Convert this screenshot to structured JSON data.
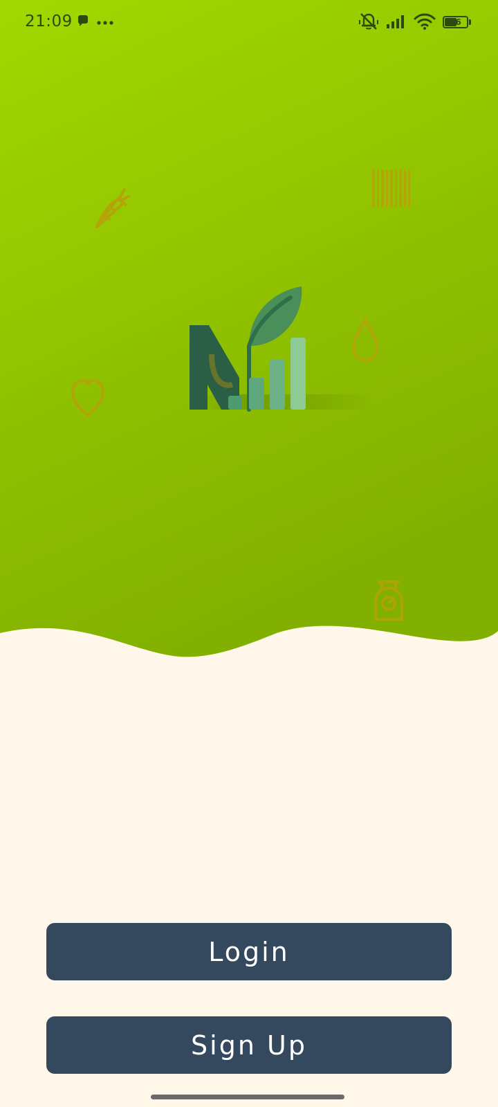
{
  "status_bar": {
    "time": "21:09",
    "battery_level": "56",
    "left_icons": [
      "chat-bubble-icon",
      "more-dots-icon"
    ],
    "right_icons": [
      "vibrate-mute-icon",
      "signal-icon",
      "wifi-icon",
      "battery-icon"
    ]
  },
  "hero": {
    "gradient_top": "#A2D800",
    "gradient_bottom": "#82B000",
    "doodle_color": "#B8A00A",
    "doodles": [
      "carrot-icon",
      "barcode-icon",
      "water-drop-icon",
      "heart-icon",
      "scale-icon"
    ],
    "logo": {
      "name": "app-logo",
      "colors": {
        "letter": "#2A5E45",
        "leaf": "#4A8F5A",
        "bar_1": "#4E9A72",
        "bar_2": "#6DB287",
        "bar_3": "#8ECA94"
      }
    }
  },
  "background_color": "#FEF7EA",
  "buttons": {
    "login_label": "Login",
    "signup_label": "Sign Up",
    "color": "#34495E"
  }
}
